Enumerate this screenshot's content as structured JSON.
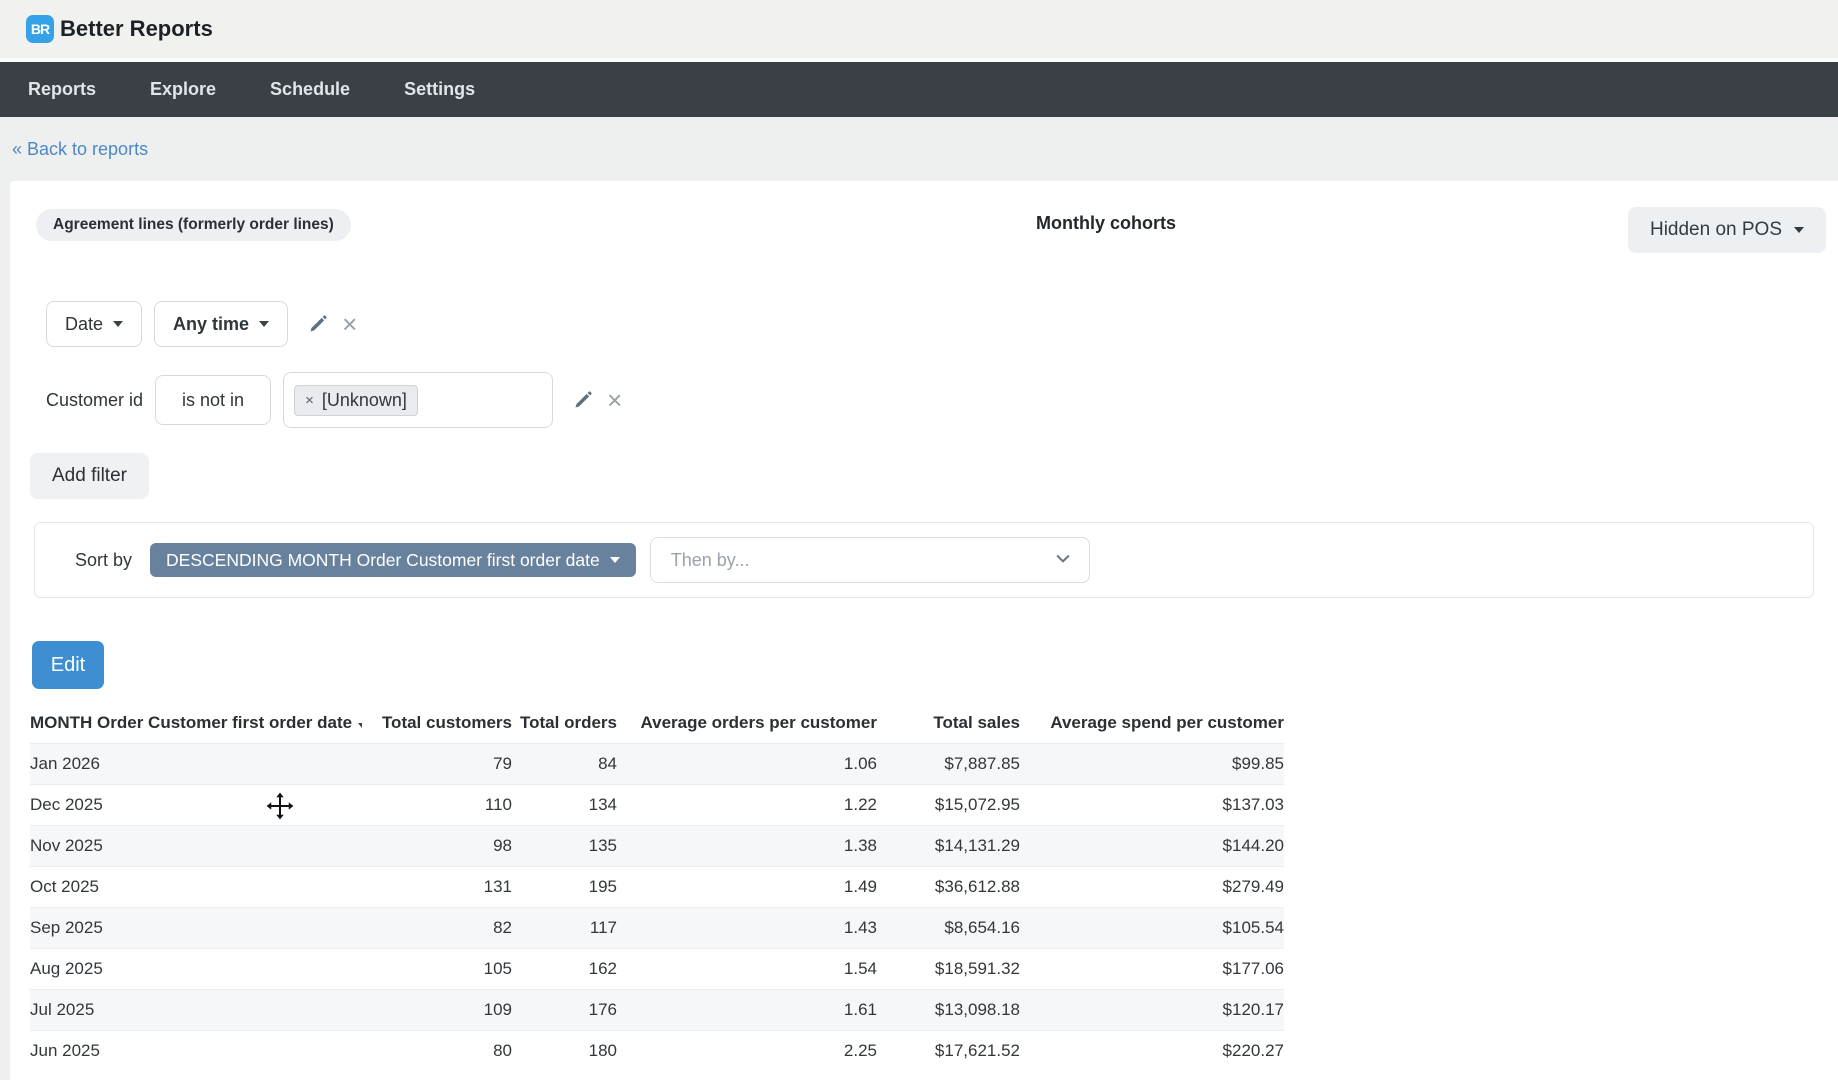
{
  "app": {
    "logo": "BR",
    "name": "Better Reports"
  },
  "nav": {
    "items": [
      "Reports",
      "Explore",
      "Schedule",
      "Settings"
    ]
  },
  "back_link": {
    "label": "« Back to reports"
  },
  "report_header": {
    "source_badge": "Agreement lines (formerly order lines)",
    "title": "Monthly cohorts",
    "pos_visibility_button": "Hidden on POS"
  },
  "filters": {
    "date_filter": {
      "field": "Date",
      "value": "Any time"
    },
    "customer_filter": {
      "field": "Customer id",
      "operator": "is not in",
      "tag_remove": "×",
      "tag_value": "[Unknown]"
    },
    "add_button": "Add filter"
  },
  "sorting": {
    "label": "Sort by",
    "primary_sort": "DESCENDING MONTH Order Customer first order date",
    "then_by_placeholder": "Then by..."
  },
  "actions": {
    "edit_button": "Edit"
  },
  "table": {
    "columns": [
      "MONTH Order Customer first order date",
      "Total customers",
      "Total orders",
      "Average orders per customer",
      "Total sales",
      "Average spend per customer"
    ],
    "rows": [
      {
        "month": "Jan 2026",
        "total_customers": "79",
        "total_orders": "84",
        "avg_orders": "1.06",
        "total_sales": "$7,887.85",
        "avg_spend": "$99.85"
      },
      {
        "month": "Dec 2025",
        "total_customers": "110",
        "total_orders": "134",
        "avg_orders": "1.22",
        "total_sales": "$15,072.95",
        "avg_spend": "$137.03"
      },
      {
        "month": "Nov 2025",
        "total_customers": "98",
        "total_orders": "135",
        "avg_orders": "1.38",
        "total_sales": "$14,131.29",
        "avg_spend": "$144.20"
      },
      {
        "month": "Oct 2025",
        "total_customers": "131",
        "total_orders": "195",
        "avg_orders": "1.49",
        "total_sales": "$36,612.88",
        "avg_spend": "$279.49"
      },
      {
        "month": "Sep 2025",
        "total_customers": "82",
        "total_orders": "117",
        "avg_orders": "1.43",
        "total_sales": "$8,654.16",
        "avg_spend": "$105.54"
      },
      {
        "month": "Aug 2025",
        "total_customers": "105",
        "total_orders": "162",
        "avg_orders": "1.54",
        "total_sales": "$18,591.32",
        "avg_spend": "$177.06"
      },
      {
        "month": "Jul 2025",
        "total_customers": "109",
        "total_orders": "176",
        "avg_orders": "1.61",
        "total_sales": "$13,098.18",
        "avg_spend": "$120.17"
      },
      {
        "month": "Jun 2025",
        "total_customers": "80",
        "total_orders": "180",
        "avg_orders": "2.25",
        "total_sales": "$17,621.52",
        "avg_spend": "$220.27"
      }
    ]
  },
  "colors": {
    "accent_blue": "#3e8fd2",
    "logo_blue": "#35a2e7",
    "nav_dark": "#3a4046",
    "sort_pill_blue": "#68829e",
    "link_blue": "#4d87c5",
    "page_bg": "#eef0ef",
    "row_stripe": "#f6f7f9"
  }
}
